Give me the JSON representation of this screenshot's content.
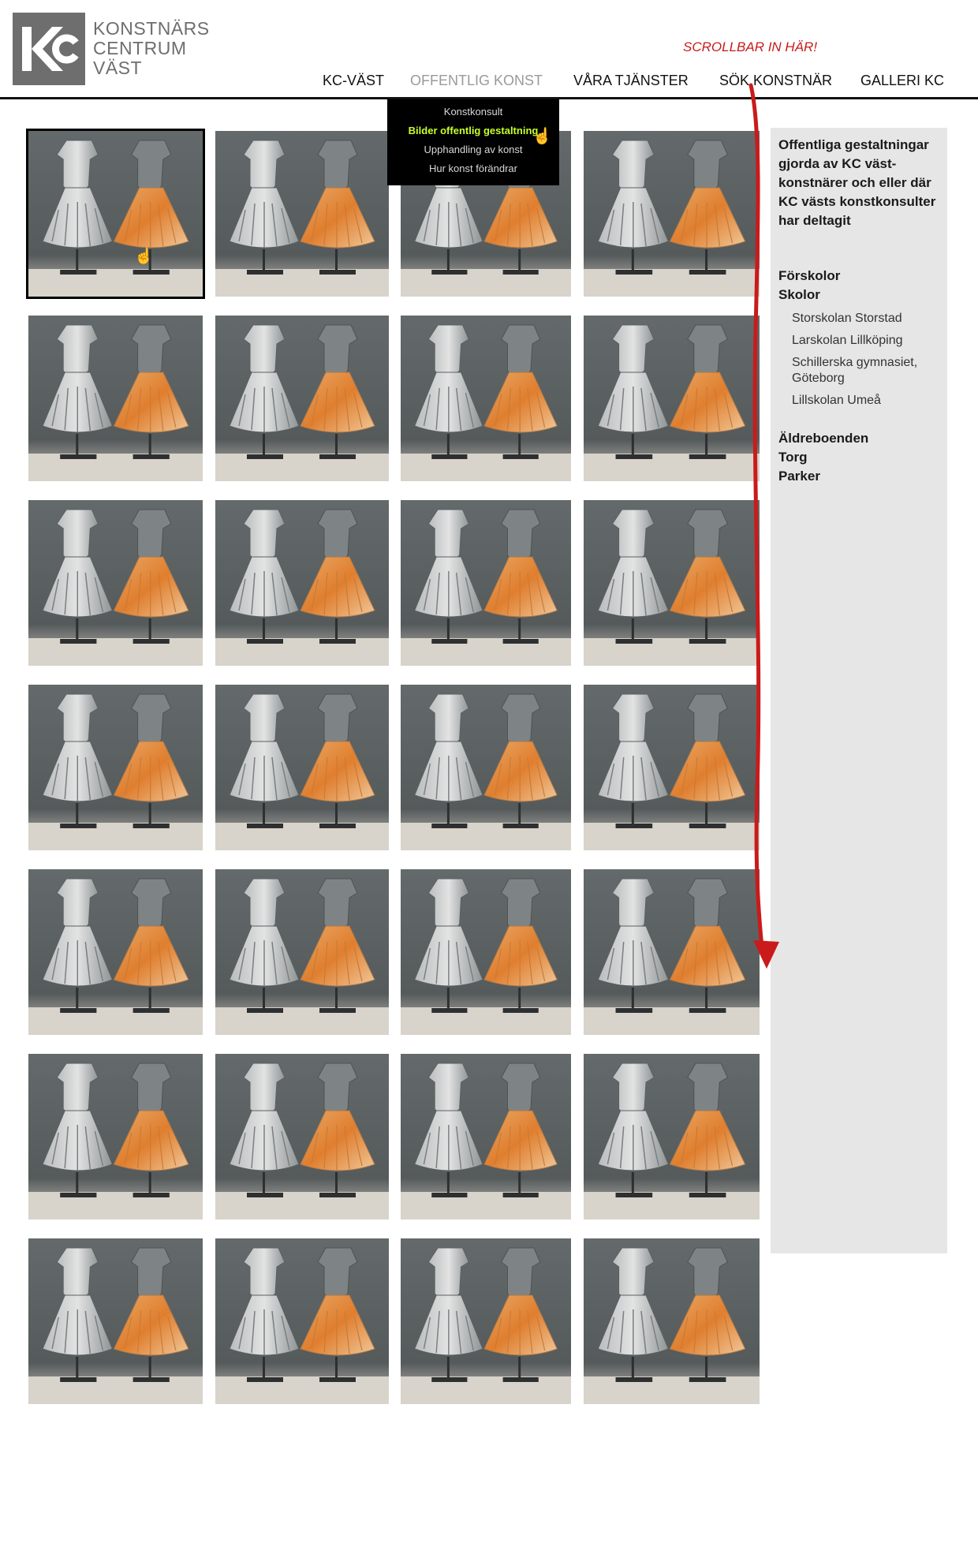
{
  "logo": {
    "line1": "KONSTNÄRS",
    "line2": "CENTRUM",
    "line3": "VÄST"
  },
  "annotation": {
    "scroll_note": "SCROLLBAR IN HÄR!"
  },
  "nav": {
    "items": [
      {
        "label": "KC-VÄST",
        "active": false
      },
      {
        "label": "OFFENTLIG KONST",
        "active": true
      },
      {
        "label": "VÅRA TJÄNSTER",
        "active": false
      },
      {
        "label": "SÖK KONSTNÄR",
        "active": false
      },
      {
        "label": "GALLERI KC",
        "active": false
      }
    ]
  },
  "dropdown": {
    "items": [
      {
        "label": "Konstkonsult",
        "active": false
      },
      {
        "label": "Bilder offentlig gestaltning",
        "active": true
      },
      {
        "label": "Upphandling av konst",
        "active": false
      },
      {
        "label": "Hur konst förändrar",
        "active": false
      }
    ]
  },
  "gallery": {
    "rows": 7,
    "cols": 4,
    "selected_index": 0
  },
  "sidebar": {
    "intro": "Offentliga gestaltningar gjorda av KC väst-konstnärer och eller där KC västs konstkonsulter har deltagit",
    "categories": [
      {
        "label": "Förskolor"
      },
      {
        "label": "Skolor"
      },
      {
        "label": "Äldreboenden"
      },
      {
        "label": "Torg"
      },
      {
        "label": "Parker"
      }
    ],
    "schools": [
      "Storskolan Storstad",
      "Larskolan Lillköping",
      "Schillerska gymnasiet, Göteborg",
      "Lillskolan Umeå"
    ]
  },
  "colors": {
    "annotation_red": "#c91b1b",
    "dropdown_active": "#c6ff2b",
    "sidebar_bg": "#e6e6e6",
    "logo_gray": "#6e6e6e"
  }
}
